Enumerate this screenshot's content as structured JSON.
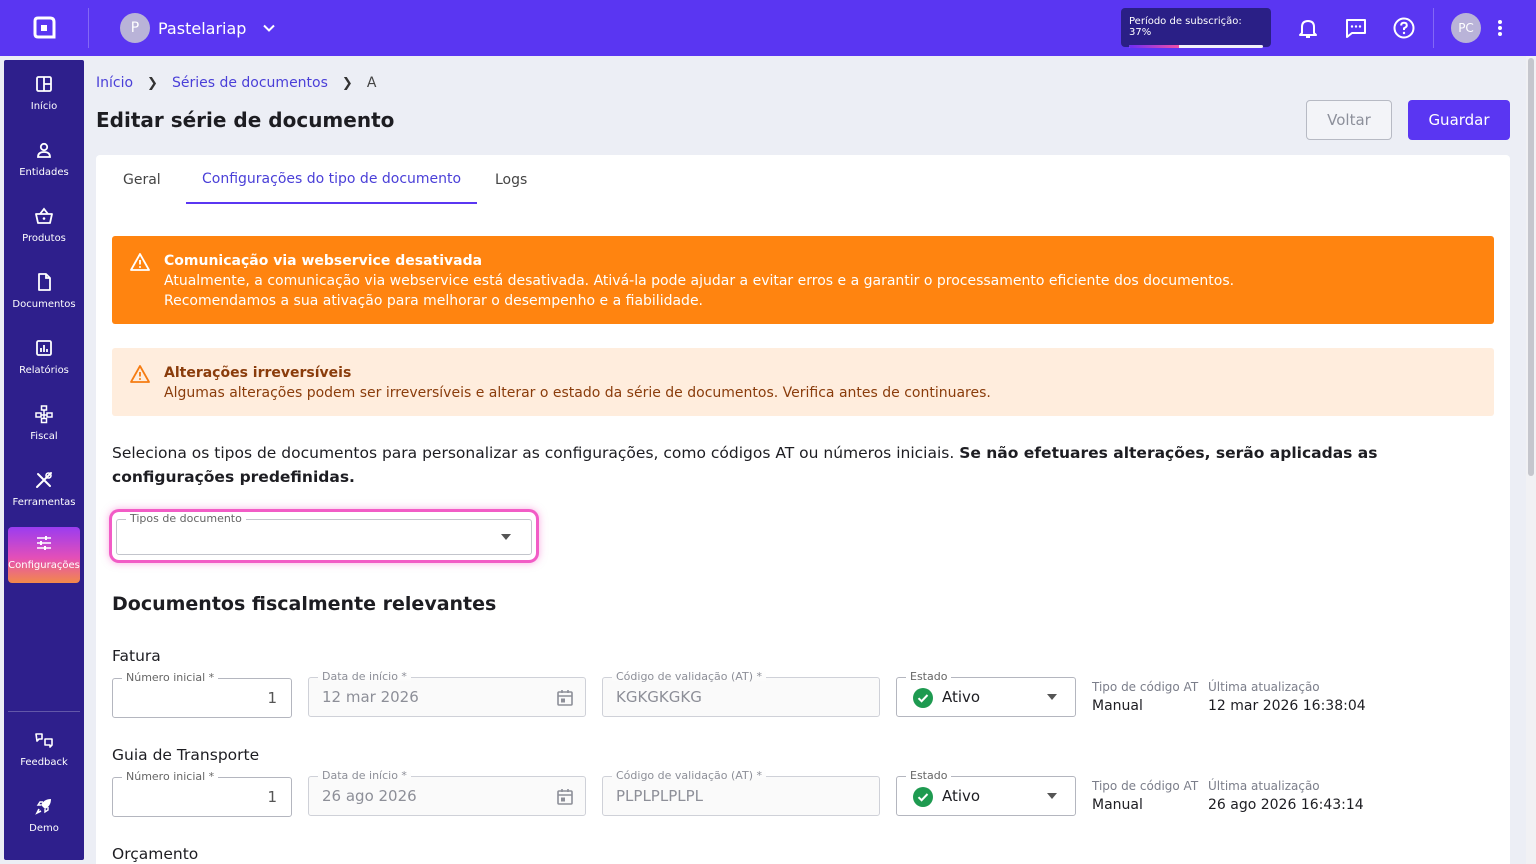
{
  "topbar": {
    "company_initial": "P",
    "company_name": "Pastelariap",
    "subscription_label": "Período de subscrição: 37%",
    "subscription_progress": 0.37,
    "user_initials": "PC"
  },
  "sidebar": {
    "items": [
      {
        "label": "Início",
        "icon": "grid-icon"
      },
      {
        "label": "Entidades",
        "icon": "user-icon"
      },
      {
        "label": "Produtos",
        "icon": "basket-icon"
      },
      {
        "label": "Documentos",
        "icon": "document-icon"
      },
      {
        "label": "Relatórios",
        "icon": "chart-icon"
      },
      {
        "label": "Fiscal",
        "icon": "network-icon"
      },
      {
        "label": "Ferramentas",
        "icon": "tools-icon"
      },
      {
        "label": "Configurações",
        "icon": "sliders-icon",
        "active": true
      }
    ],
    "bottom": [
      {
        "label": "Feedback",
        "icon": "feedback-icon"
      },
      {
        "label": "Demo",
        "icon": "rocket-icon"
      }
    ]
  },
  "breadcrumb": {
    "items": [
      "Início",
      "Séries de documentos",
      "A"
    ]
  },
  "header": {
    "title": "Editar série de documento",
    "back_label": "Voltar",
    "save_label": "Guardar"
  },
  "tabs": [
    {
      "label": "Geral"
    },
    {
      "label": "Configurações do tipo de documento",
      "active": true
    },
    {
      "label": "Logs"
    }
  ],
  "alerts": {
    "webservice": {
      "title": "Comunicação via webservice desativada",
      "line1": "Atualmente, a comunicação via webservice está desativada. Ativá-la pode ajudar a evitar erros e a garantir o processamento eficiente dos documentos.",
      "line2": "Recomendamos a sua ativação para melhorar o desempenho e a fiabilidade."
    },
    "irreversible": {
      "title": "Alterações irreversíveis",
      "text": "Algumas alterações podem ser irreversíveis e alterar o estado da série de documentos. Verifica antes de continuares."
    }
  },
  "intro": {
    "text": "Seleciona os tipos de documentos para personalizar as configurações, como códigos AT ou números iniciais. ",
    "bold": "Se não efetuares alterações, serão aplicadas as configurações predefinidas."
  },
  "doc_type_select": {
    "label": "Tipos de documento",
    "value": ""
  },
  "section": {
    "title": "Documentos fiscalmente relevantes"
  },
  "field_labels": {
    "initial_number": "Número inicial *",
    "start_date": "Data de início *",
    "validation_code": "Código de validação (AT) *",
    "status": "Estado",
    "at_code_type": "Tipo de código AT",
    "last_update": "Última atualização"
  },
  "documents": [
    {
      "name": "Fatura",
      "initial_number": "1",
      "start_date": "12 mar 2026",
      "validation_code": "KGKGKGKG",
      "status": "Ativo",
      "at_code_type": "Manual",
      "last_update": "12 mar 2026 16:38:04"
    },
    {
      "name": "Guia de Transporte",
      "initial_number": "1",
      "start_date": "26 ago 2026",
      "validation_code": "PLPLPLPLPL",
      "status": "Ativo",
      "at_code_type": "Manual",
      "last_update": "26 ago 2026 16:43:14"
    },
    {
      "name": "Orçamento"
    }
  ],
  "colors": {
    "brand": "#5a36f2",
    "sidebar": "#2e1f8c",
    "warning": "#ff8410",
    "warning_light": "#ffeddd",
    "success": "#1e9a50"
  }
}
